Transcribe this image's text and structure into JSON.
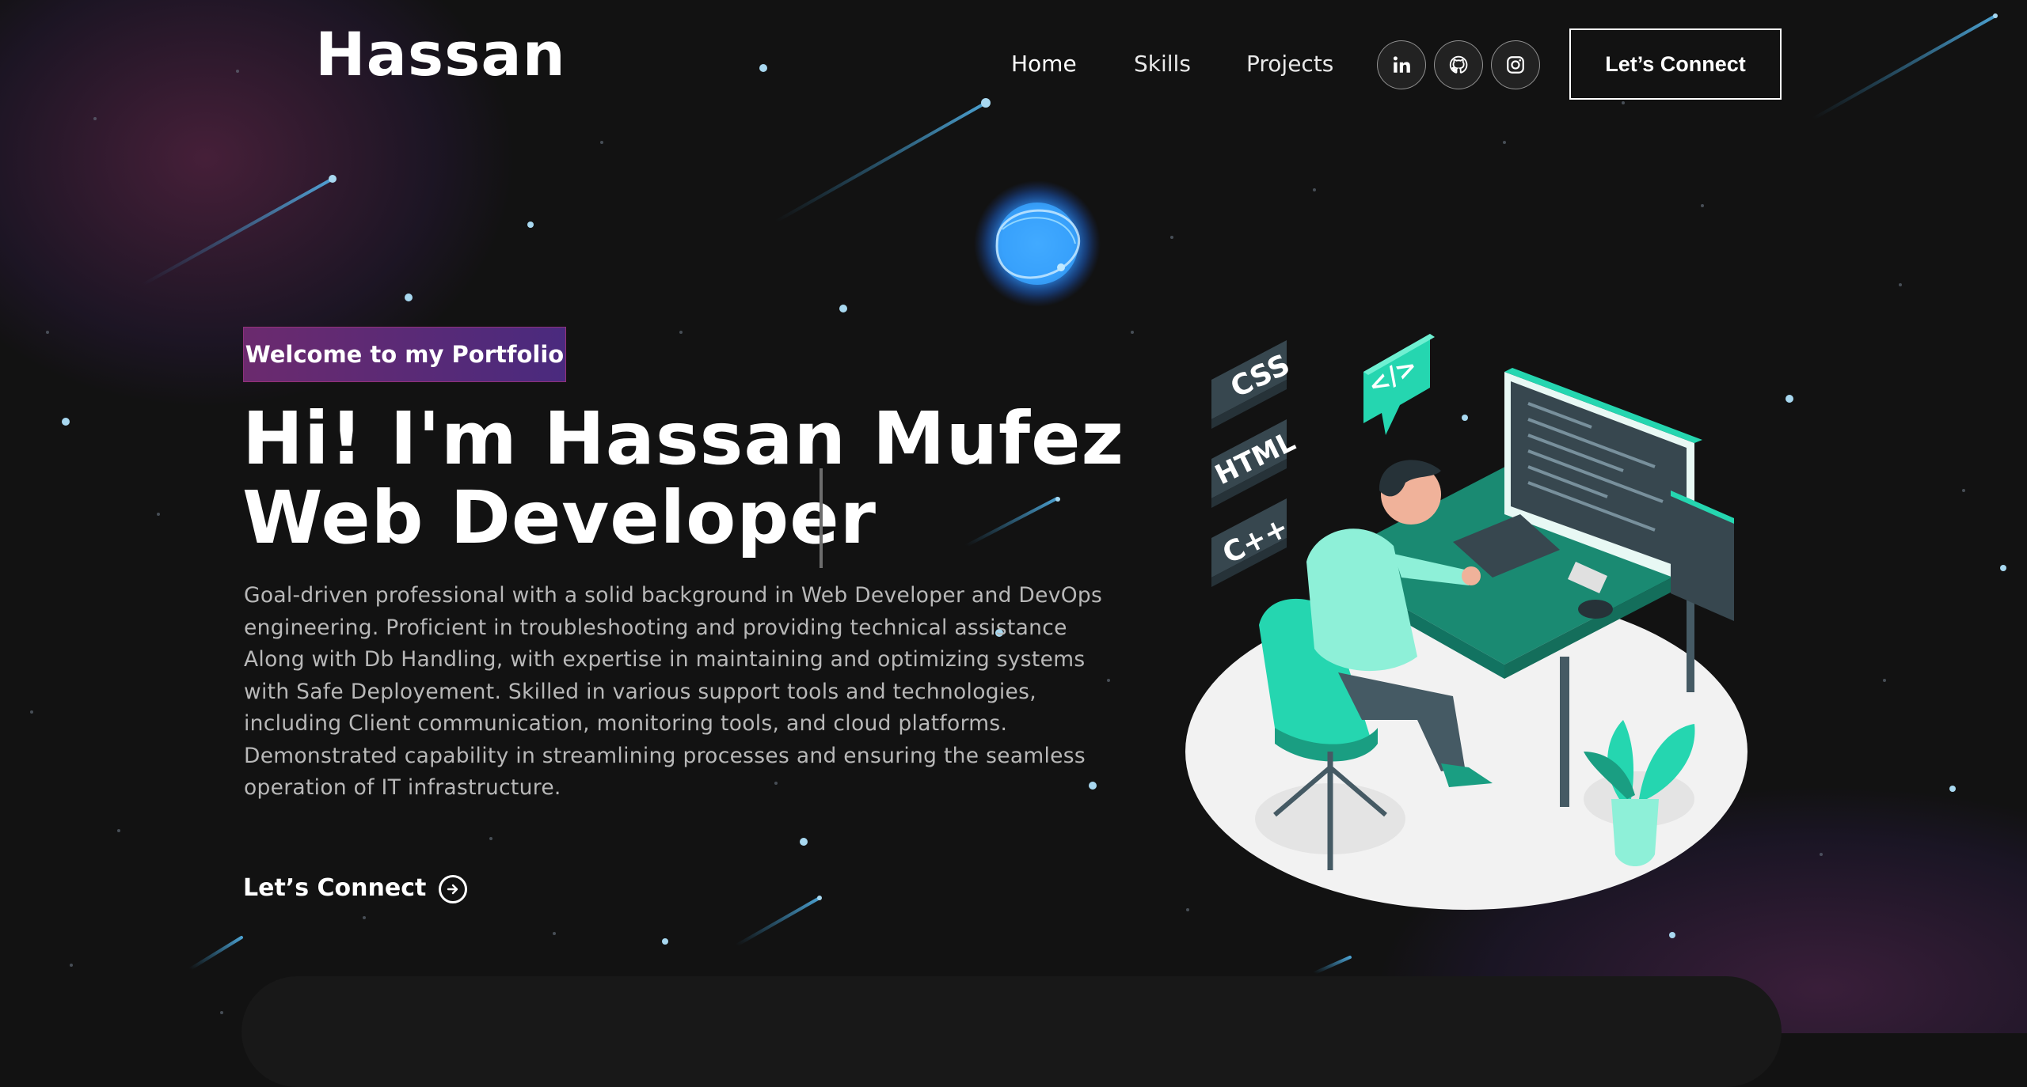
{
  "nav": {
    "brand": "Hassan",
    "links": [
      {
        "label": "Home"
      },
      {
        "label": "Skills"
      },
      {
        "label": "Projects"
      }
    ],
    "social_icons": [
      "linkedin-icon",
      "github-icon",
      "instagram-icon"
    ],
    "cta_label": "Let’s Connect"
  },
  "hero": {
    "tagline": "Welcome to my Portfolio",
    "title_line1": "Hi! I'm Hassan Mufez",
    "title_line2": "Web Developer",
    "description": "Goal-driven professional with a solid background in Web Developer and DevOps engineering. Proficient in troubleshooting and providing technical assistance Along with Db Handling, with expertise in maintaining and optimizing systems with Safe Deployement. Skilled in various support tools and technologies, including Client communication, monitoring tools, and cloud platforms. Demonstrated capability in streamlining processes and ensuring the seamless operation of IT infrastructure.",
    "connect_label": "Let’s Connect"
  },
  "illustration": {
    "badges": [
      "CSS",
      "HTML",
      "C++"
    ],
    "code_bubble": "</>"
  },
  "colors": {
    "background": "#121212",
    "accent_teal": "#25d6b0",
    "tagline_gradient_start": "#6b2a6e",
    "tagline_gradient_end": "#4a2a7e"
  }
}
